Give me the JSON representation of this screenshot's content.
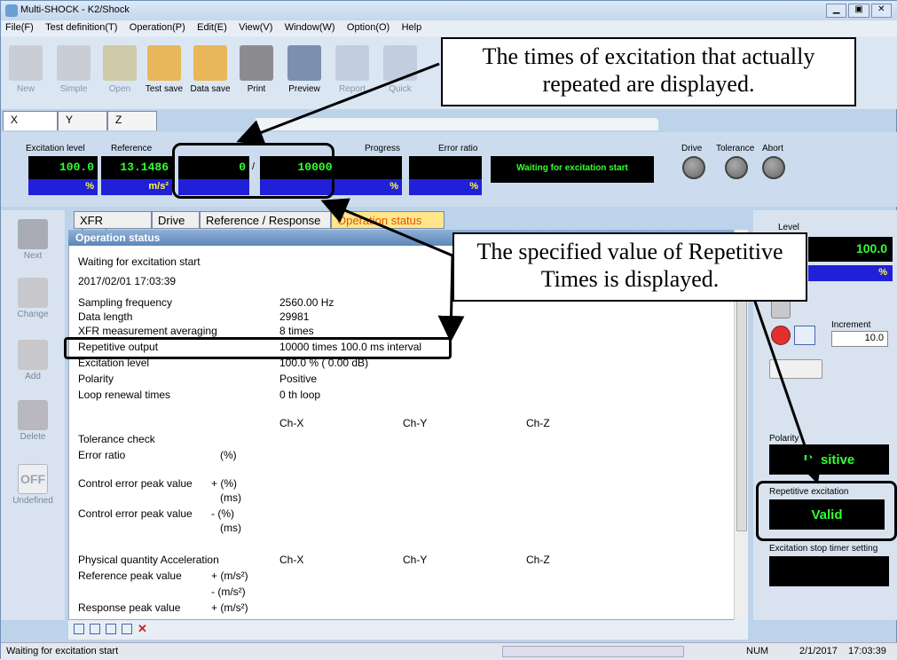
{
  "window": {
    "title": "Multi-SHOCK - K2/Shock"
  },
  "menu": [
    "File(F)",
    "Test definition(T)",
    "Operation(P)",
    "Edit(E)",
    "View(V)",
    "Window(W)",
    "Option(O)",
    "Help"
  ],
  "toolbar": {
    "new": "New",
    "simple": "Simple",
    "open": "Open",
    "test_save": "Test save",
    "data_save": "Data save",
    "print": "Print",
    "preview": "Preview",
    "report": "Report",
    "quick": "Quick"
  },
  "axis_tabs": [
    "X",
    "Y",
    "Z"
  ],
  "params": {
    "excitation_level_label": "Excitation level",
    "reference_label": "Reference",
    "progress_label": "Progress",
    "error_ratio_label": "Error ratio",
    "excitation_level_value": "100.0",
    "reference_value": "13.1486",
    "repeat_count_value": "0",
    "slash": "/",
    "repeat_total_value": "10000",
    "percent_unit": "%",
    "ms2_unit": "m/s²",
    "status_text": "Waiting for excitation start",
    "drive_label": "Drive",
    "tolerance_label": "Tolerance",
    "abort_label": "Abort"
  },
  "left_tools": {
    "next": "Next",
    "change": "Change",
    "add": "Add",
    "delete": "Delete",
    "undefined": "Undefined",
    "off": "OFF"
  },
  "content_tabs": [
    "XFR function",
    "Drive",
    "Reference / Response",
    "Operation status"
  ],
  "operation": {
    "header": "Operation status",
    "status": "Waiting for excitation start",
    "timestamp": "2017/02/01 17:03:39",
    "sampling_label": "Sampling frequency",
    "sampling_value": "2560.00 Hz",
    "data_length_label": "Data length",
    "data_length_value": "29981",
    "xfr_label": "XFR measurement averaging",
    "xfr_value": "8 times",
    "repetitive_label": "Repetitive output",
    "repetitive_value": "10000 times 100.0 ms interval",
    "exc_level_label": "Excitation level",
    "exc_level_value": "100.0 % ( 0.00 dB)",
    "polarity_label": "Polarity",
    "polarity_value": "Positive",
    "loop_label": "Loop renewal times",
    "loop_value": "0 th loop",
    "ch_x": "Ch-X",
    "ch_y": "Ch-Y",
    "ch_z": "Ch-Z",
    "tolerance_check": "Tolerance check",
    "error_ratio": "Error ratio",
    "pct_unit": "(%)",
    "ctrl_err_label": "Control error peak value",
    "plus_pct": "+ (%)",
    "minus_pct": "- (%)",
    "ms_unit": "(ms)",
    "phys_label": "Physical quantity Acceleration",
    "ref_peak_label": "Reference peak value",
    "plus_ms2": "+ (m/s²)",
    "minus_ms2": "- (m/s²)",
    "resp_peak_label": "Response peak value"
  },
  "right": {
    "level_label": "Level",
    "level_value": "100.0",
    "level_unit": "%",
    "increment_label": "Increment",
    "increment_value": "10.0",
    "polarity_label": "Polarity",
    "polarity_value": "Positive",
    "repetitive_label": "Repetitive excitation",
    "repetitive_value": "Valid",
    "timer_label": "Excitation stop timer setting"
  },
  "statusbar": {
    "text": "Waiting for excitation start",
    "num": "NUM",
    "date": "2/1/2017",
    "time": "17:03:39"
  },
  "callouts": {
    "top": "The times of excitation that actually repeated are displayed.",
    "middle": "The specified value of Repetitive Times is displayed."
  }
}
